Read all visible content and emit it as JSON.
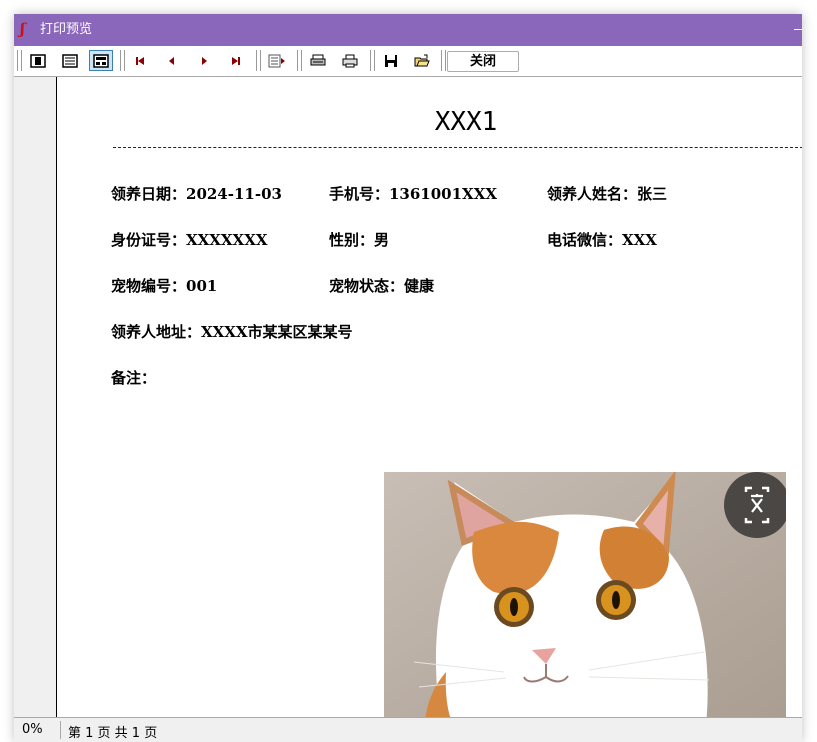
{
  "window": {
    "title": "打印预览",
    "app_icon": "foxpro-app-icon"
  },
  "toolbar": {
    "buttons": [
      {
        "icon": "one-page-view-icon"
      },
      {
        "icon": "two-page-view-icon"
      },
      {
        "icon": "fit-page-view-icon"
      },
      {
        "icon": "first-page-icon"
      },
      {
        "icon": "previous-page-icon"
      },
      {
        "icon": "next-page-icon"
      },
      {
        "icon": "last-page-icon"
      },
      {
        "icon": "goto-page-icon"
      },
      {
        "icon": "print-setup-icon"
      },
      {
        "icon": "print-icon"
      },
      {
        "icon": "save-icon"
      },
      {
        "icon": "open-folder-icon"
      }
    ],
    "close_label": "关闭"
  },
  "report": {
    "title": "XXX1",
    "adopt_date": "领养日期：2024-11-03",
    "phone": "手机号：1361001XXX",
    "adopter_name": "领养人姓名：张三",
    "id_number": "身份证号：XXXXXXX",
    "gender": "性别：男",
    "wechat": "电话微信：XXX",
    "pet_number": "宠物编号：001",
    "pet_status": "宠物状态：健康",
    "address": "领养人地址：XXXX市某某区某某号",
    "remarks": "备注：",
    "photo": "cat-photo"
  },
  "status": {
    "zoom": "0%",
    "page_info": "第 1 页 共 1 页"
  },
  "colors": {
    "titlebar": "#8a67bb",
    "active_button": "#cce4f7",
    "nav_arrow": "#8b0000"
  }
}
